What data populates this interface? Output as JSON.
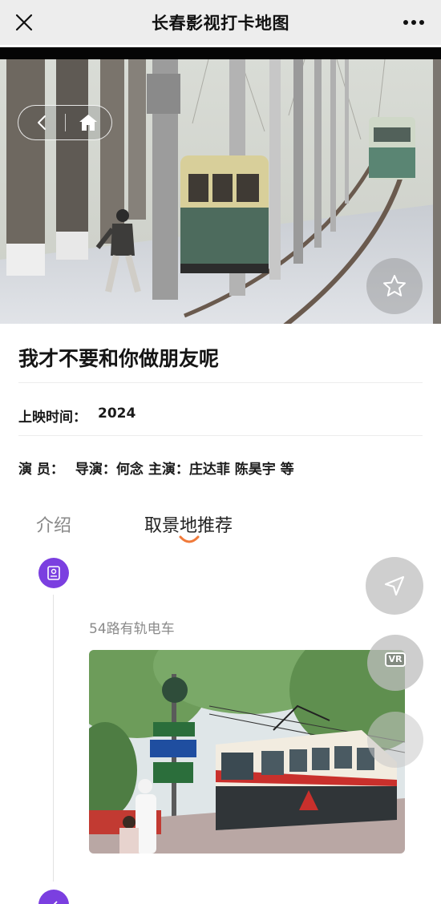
{
  "navbar": {
    "title": "长春影视打卡地图",
    "close_icon": "close-icon",
    "more_icon": "more-dots-icon"
  },
  "hero": {
    "back_icon": "chevron-left-icon",
    "home_icon": "home-icon",
    "favorite_icon": "star-outline-icon",
    "slide_count": 1,
    "active_slide": 1
  },
  "movie": {
    "title": "我才不要和你做朋友呢",
    "release_label": "上映时间：",
    "release_value": "2024",
    "cast_label": "演 员：",
    "cast_value": "导演：何念 主演：庄达菲 陈昊宇 等"
  },
  "tabs": [
    {
      "label": "介绍",
      "active": false
    },
    {
      "label": "取景地推荐",
      "active": true
    }
  ],
  "locations": [
    {
      "name": "54路有轨电车",
      "icon": "id-card-icon"
    }
  ],
  "floating": {
    "navigate_icon": "navigation-arrow-icon",
    "vr_label": "VR"
  },
  "colors": {
    "accent_purple": "#7b3fe0",
    "tab_indicator": "#f07a3a",
    "navbar_bg": "#ededed"
  }
}
